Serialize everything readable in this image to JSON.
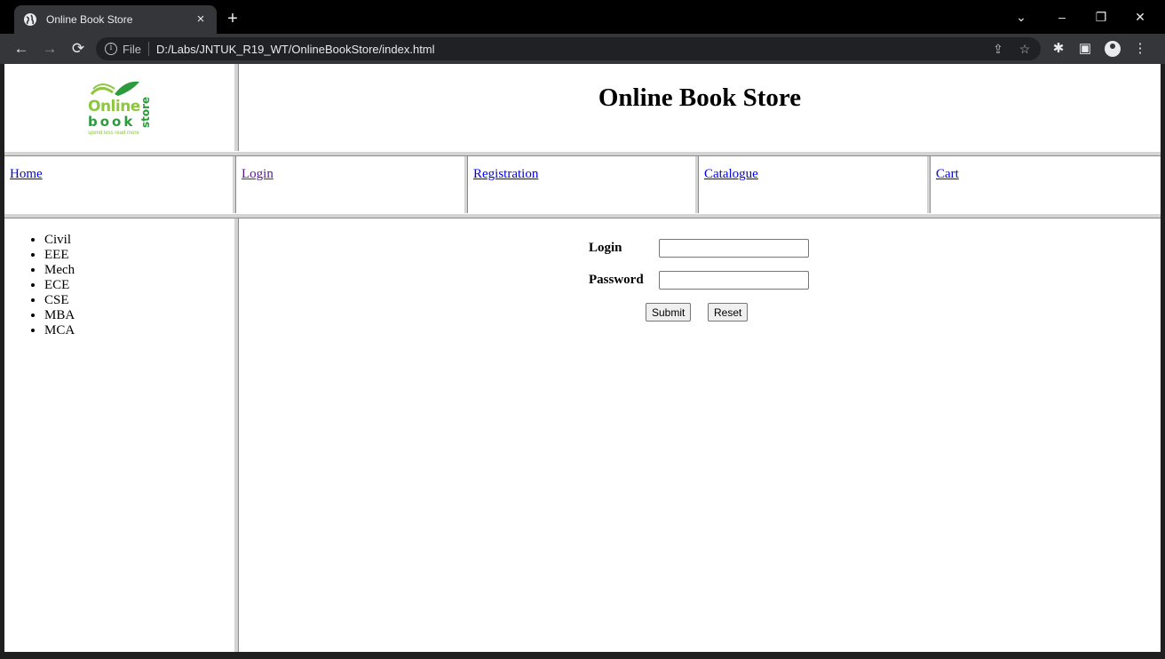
{
  "browser": {
    "tab_title": "Online Book Store",
    "tab_close": "×",
    "new_tab": "+",
    "scheme_label": "File",
    "url": "D:/Labs/JNTUK_R19_WT/OnlineBookStore/index.html",
    "icons": {
      "back": "←",
      "forward": "→",
      "reload": "⟳",
      "info": "i",
      "share": "⇪",
      "star": "☆",
      "extensions": "✱",
      "sidepanel": "▣",
      "menu": "⋮",
      "minimize": "–",
      "restore": "❐",
      "close": "✕",
      "tab_search": "⌄"
    }
  },
  "header": {
    "logo": {
      "line1": "Online",
      "line2": "book",
      "vertical": "store",
      "tagline": "spend less read more"
    },
    "title": "Online Book Store"
  },
  "nav": {
    "links": [
      {
        "label": "Home",
        "visited": false
      },
      {
        "label": "Login",
        "visited": true
      },
      {
        "label": "Registration",
        "visited": false
      },
      {
        "label": "Catalogue",
        "visited": false
      },
      {
        "label": "Cart",
        "visited": false
      }
    ]
  },
  "sidebar": {
    "branches": [
      "Civil",
      "EEE",
      "Mech",
      "ECE",
      "CSE",
      "MBA",
      "MCA"
    ]
  },
  "login_form": {
    "login_label": "Login",
    "login_value": "",
    "password_label": "Password",
    "password_value": "",
    "submit_label": "Submit",
    "reset_label": "Reset"
  },
  "colors": {
    "link": "#0000ee",
    "visited_link": "#551a8b",
    "logo_light_green": "#8dc63f",
    "logo_dark_green": "#2e9a3e",
    "frame_border": "#d4d4d4"
  }
}
